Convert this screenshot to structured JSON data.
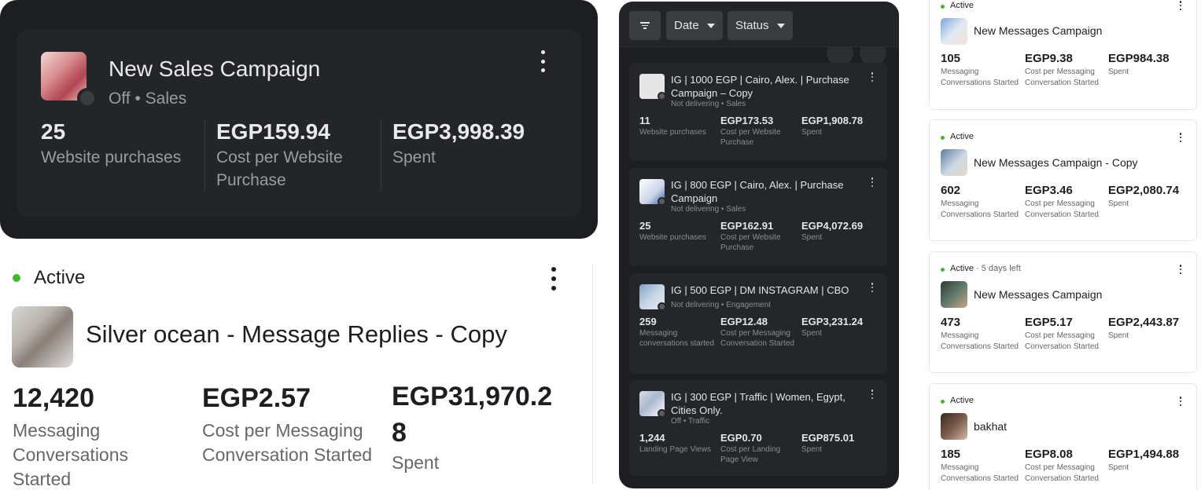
{
  "colors": {
    "active_green": "#42b72a",
    "dark_bg": "#1c1e21",
    "text_dark": "#1c1e21",
    "text_muted": "#65676b"
  },
  "panel1": {
    "title": "New Sales Campaign",
    "status": "Off",
    "separator": "•",
    "objective": "Sales",
    "metrics": [
      {
        "value": "25",
        "label": "Website purchases"
      },
      {
        "value": "EGP159.94",
        "label": "Cost per Website Purchase"
      },
      {
        "value": "EGP3,998.39",
        "label": "Spent"
      }
    ]
  },
  "panel2": {
    "status": "Active",
    "title": "Silver ocean - Message Replies - Copy",
    "metrics": [
      {
        "value": "12,420",
        "label": "Messaging Conversations Started"
      },
      {
        "value": "EGP2.57",
        "label": "Cost per Messaging Conversation Started"
      },
      {
        "value": "EGP31,970.28",
        "label": "Spent"
      }
    ]
  },
  "panel3": {
    "filters": {
      "filter_icon": "filter-icon",
      "date": "Date",
      "status": "Status"
    },
    "campaigns": [
      {
        "title": "IG | 1000 EGP | Cairo, Alex. | Purchase Campaign – Copy",
        "delivery": "Not delivering",
        "objective": "Sales",
        "metrics": [
          {
            "value": "11",
            "label": "Website purchases"
          },
          {
            "value": "EGP173.53",
            "label": "Cost per Website Purchase"
          },
          {
            "value": "EGP1,908.78",
            "label": "Spent"
          }
        ]
      },
      {
        "title": "IG | 800 EGP | Cairo, Alex. | Purchase Campaign",
        "delivery": "Not delivering",
        "objective": "Sales",
        "metrics": [
          {
            "value": "25",
            "label": "Website purchases"
          },
          {
            "value": "EGP162.91",
            "label": "Cost per Website Purchase"
          },
          {
            "value": "EGP4,072.69",
            "label": "Spent"
          }
        ]
      },
      {
        "title": "IG | 500 EGP | DM INSTAGRAM | CBO",
        "delivery": "Not delivering",
        "objective": "Engagement",
        "metrics": [
          {
            "value": "259",
            "label": "Messaging conversations started"
          },
          {
            "value": "EGP12.48",
            "label": "Cost per Messaging Conversation Started"
          },
          {
            "value": "EGP3,231.24",
            "label": "Spent"
          }
        ]
      },
      {
        "title": "IG | 300 EGP | Traffic | Women, Egypt, Cities Only.",
        "delivery": "Off",
        "objective": "Traffic",
        "metrics": [
          {
            "value": "1,244",
            "label": "Landing Page Views"
          },
          {
            "value": "EGP0.70",
            "label": "Cost per Landing Page View"
          },
          {
            "value": "EGP875.01",
            "label": "Spent"
          }
        ]
      }
    ]
  },
  "panel4": {
    "campaigns": [
      {
        "status": "Active",
        "extra": "",
        "title": "New Messages Campaign",
        "metrics": [
          {
            "value": "105",
            "label": "Messaging Conversations Started"
          },
          {
            "value": "EGP9.38",
            "label": "Cost per Messaging Conversation Started"
          },
          {
            "value": "EGP984.38",
            "label": "Spent"
          }
        ]
      },
      {
        "status": "Active",
        "extra": "",
        "title": "New Messages Campaign - Copy",
        "metrics": [
          {
            "value": "602",
            "label": "Messaging Conversations Started"
          },
          {
            "value": "EGP3.46",
            "label": "Cost per Messaging Conversation Started"
          },
          {
            "value": "EGP2,080.74",
            "label": "Spent"
          }
        ]
      },
      {
        "status": "Active",
        "extra": " · 5 days left",
        "title": "New Messages Campaign",
        "metrics": [
          {
            "value": "473",
            "label": "Messaging Conversations Started"
          },
          {
            "value": "EGP5.17",
            "label": "Cost per Messaging Conversation Started"
          },
          {
            "value": "EGP2,443.87",
            "label": "Spent"
          }
        ]
      },
      {
        "status": "Active",
        "extra": "",
        "title": "bakhat",
        "metrics": [
          {
            "value": "185",
            "label": "Messaging Conversations Started"
          },
          {
            "value": "EGP8.08",
            "label": "Cost per Messaging Conversation Started"
          },
          {
            "value": "EGP1,494.88",
            "label": "Spent"
          }
        ]
      }
    ]
  }
}
